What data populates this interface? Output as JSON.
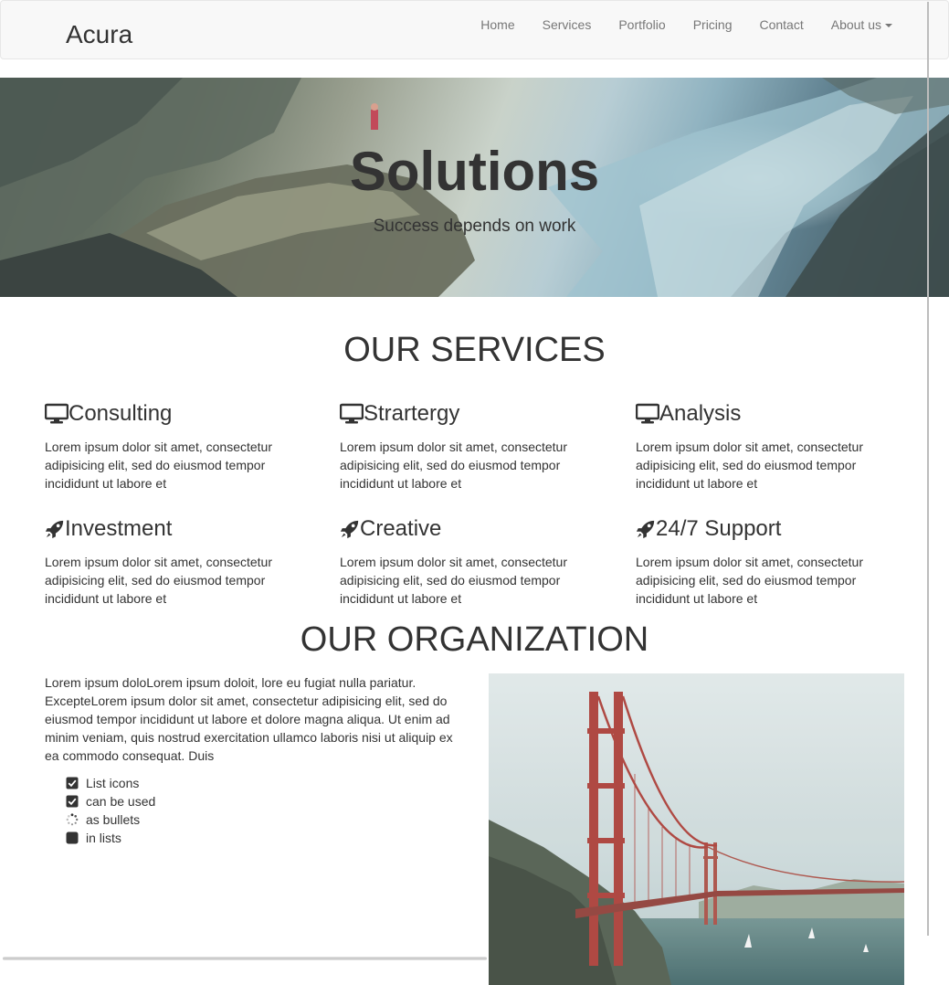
{
  "navbar": {
    "brand": "Acura",
    "links": [
      "Home",
      "Services",
      "Portfolio",
      "Pricing",
      "Contact"
    ],
    "dropdown_label": "About us"
  },
  "hero": {
    "title": "Solutions",
    "subtitle": "Success depends on work"
  },
  "services": {
    "heading": "OUR SERVICES",
    "items": [
      {
        "icon": "desktop-icon",
        "title": "Consulting",
        "text": "Lorem ipsum dolor sit amet, consectetur adipisicing elit, sed do eiusmod tempor incididunt ut labore et"
      },
      {
        "icon": "desktop-icon",
        "title": "Strartergy",
        "text": "Lorem ipsum dolor sit amet, consectetur adipisicing elit, sed do eiusmod tempor incididunt ut labore et"
      },
      {
        "icon": "desktop-icon",
        "title": "Analysis",
        "text": "Lorem ipsum dolor sit amet, consectetur adipisicing elit, sed do eiusmod tempor incididunt ut labore et"
      },
      {
        "icon": "rocket-icon",
        "title": "Investment",
        "text": "Lorem ipsum dolor sit amet, consectetur adipisicing elit, sed do eiusmod tempor incididunt ut labore et"
      },
      {
        "icon": "rocket-icon",
        "title": "Creative",
        "text": "Lorem ipsum dolor sit amet, consectetur adipisicing elit, sed do eiusmod tempor incididunt ut labore et"
      },
      {
        "icon": "rocket-icon",
        "title": "24/7 Support",
        "text": "Lorem ipsum dolor sit amet, consectetur adipisicing elit, sed do eiusmod tempor incididunt ut labore et"
      }
    ]
  },
  "organization": {
    "heading": "OUR ORGANIZATION",
    "paragraph": "Lorem ipsum doloLorem ipsum doloit, lore eu fugiat nulla pariatur. ExcepteLorem ipsum dolor sit amet, consectetur adipisicing elit, sed do eiusmod tempor incididunt ut labore et dolore magna aliqua. Ut enim ad minim veniam, quis nostrud exercitation ullamco laboris nisi ut aliquip ex ea commodo consequat. Duis",
    "list": [
      {
        "icon": "check-square-icon",
        "label": "List icons"
      },
      {
        "icon": "check-square-icon",
        "label": "can be used"
      },
      {
        "icon": "spinner-icon",
        "label": "as bullets"
      },
      {
        "icon": "square-icon",
        "label": "in lists"
      }
    ]
  },
  "colors": {
    "text": "#333333",
    "nav_link": "#777777",
    "navbar_bg": "#f8f8f8",
    "navbar_border": "#e7e7e7"
  }
}
